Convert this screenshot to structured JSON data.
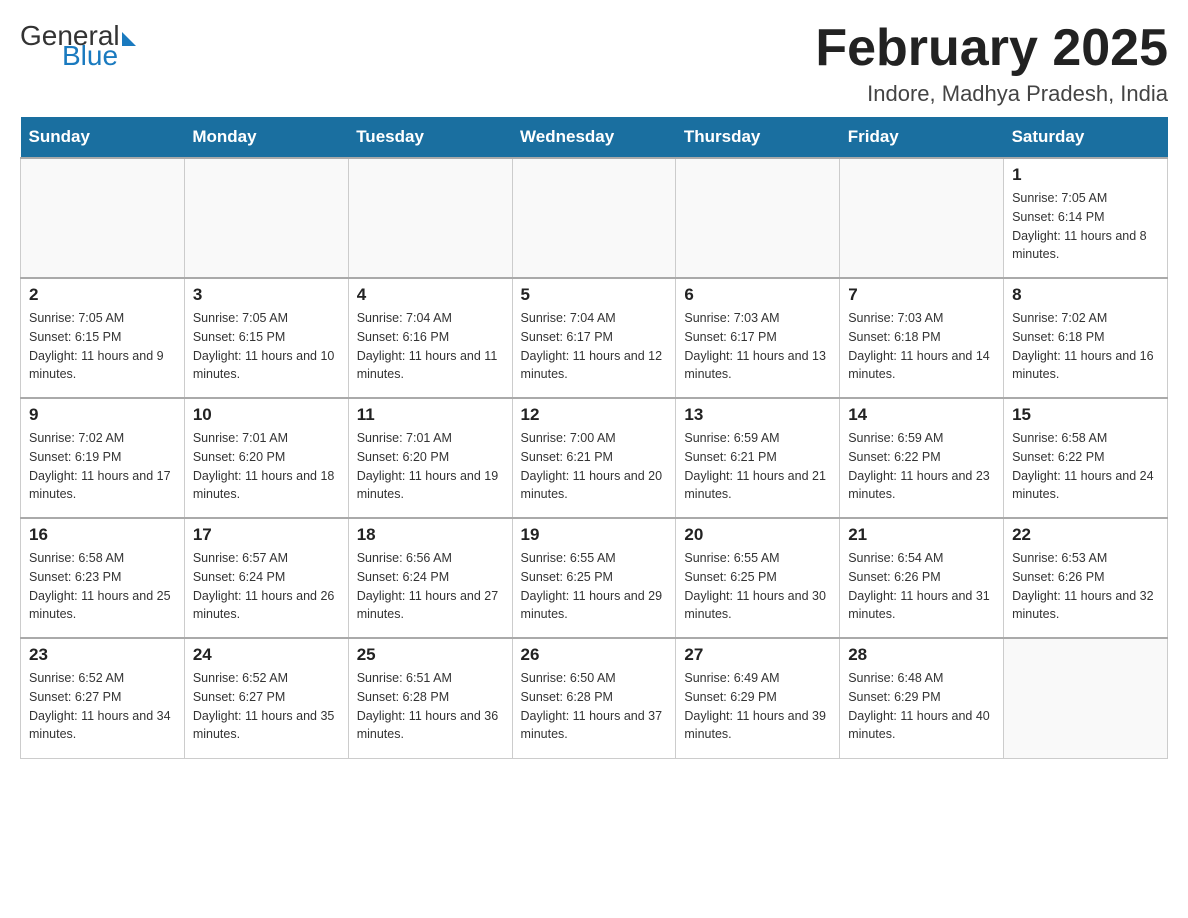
{
  "header": {
    "logo_general": "General",
    "logo_blue": "Blue",
    "month_title": "February 2025",
    "location": "Indore, Madhya Pradesh, India"
  },
  "days_of_week": [
    "Sunday",
    "Monday",
    "Tuesday",
    "Wednesday",
    "Thursday",
    "Friday",
    "Saturday"
  ],
  "weeks": [
    [
      {
        "day": "",
        "info": ""
      },
      {
        "day": "",
        "info": ""
      },
      {
        "day": "",
        "info": ""
      },
      {
        "day": "",
        "info": ""
      },
      {
        "day": "",
        "info": ""
      },
      {
        "day": "",
        "info": ""
      },
      {
        "day": "1",
        "info": "Sunrise: 7:05 AM\nSunset: 6:14 PM\nDaylight: 11 hours and 8 minutes."
      }
    ],
    [
      {
        "day": "2",
        "info": "Sunrise: 7:05 AM\nSunset: 6:15 PM\nDaylight: 11 hours and 9 minutes."
      },
      {
        "day": "3",
        "info": "Sunrise: 7:05 AM\nSunset: 6:15 PM\nDaylight: 11 hours and 10 minutes."
      },
      {
        "day": "4",
        "info": "Sunrise: 7:04 AM\nSunset: 6:16 PM\nDaylight: 11 hours and 11 minutes."
      },
      {
        "day": "5",
        "info": "Sunrise: 7:04 AM\nSunset: 6:17 PM\nDaylight: 11 hours and 12 minutes."
      },
      {
        "day": "6",
        "info": "Sunrise: 7:03 AM\nSunset: 6:17 PM\nDaylight: 11 hours and 13 minutes."
      },
      {
        "day": "7",
        "info": "Sunrise: 7:03 AM\nSunset: 6:18 PM\nDaylight: 11 hours and 14 minutes."
      },
      {
        "day": "8",
        "info": "Sunrise: 7:02 AM\nSunset: 6:18 PM\nDaylight: 11 hours and 16 minutes."
      }
    ],
    [
      {
        "day": "9",
        "info": "Sunrise: 7:02 AM\nSunset: 6:19 PM\nDaylight: 11 hours and 17 minutes."
      },
      {
        "day": "10",
        "info": "Sunrise: 7:01 AM\nSunset: 6:20 PM\nDaylight: 11 hours and 18 minutes."
      },
      {
        "day": "11",
        "info": "Sunrise: 7:01 AM\nSunset: 6:20 PM\nDaylight: 11 hours and 19 minutes."
      },
      {
        "day": "12",
        "info": "Sunrise: 7:00 AM\nSunset: 6:21 PM\nDaylight: 11 hours and 20 minutes."
      },
      {
        "day": "13",
        "info": "Sunrise: 6:59 AM\nSunset: 6:21 PM\nDaylight: 11 hours and 21 minutes."
      },
      {
        "day": "14",
        "info": "Sunrise: 6:59 AM\nSunset: 6:22 PM\nDaylight: 11 hours and 23 minutes."
      },
      {
        "day": "15",
        "info": "Sunrise: 6:58 AM\nSunset: 6:22 PM\nDaylight: 11 hours and 24 minutes."
      }
    ],
    [
      {
        "day": "16",
        "info": "Sunrise: 6:58 AM\nSunset: 6:23 PM\nDaylight: 11 hours and 25 minutes."
      },
      {
        "day": "17",
        "info": "Sunrise: 6:57 AM\nSunset: 6:24 PM\nDaylight: 11 hours and 26 minutes."
      },
      {
        "day": "18",
        "info": "Sunrise: 6:56 AM\nSunset: 6:24 PM\nDaylight: 11 hours and 27 minutes."
      },
      {
        "day": "19",
        "info": "Sunrise: 6:55 AM\nSunset: 6:25 PM\nDaylight: 11 hours and 29 minutes."
      },
      {
        "day": "20",
        "info": "Sunrise: 6:55 AM\nSunset: 6:25 PM\nDaylight: 11 hours and 30 minutes."
      },
      {
        "day": "21",
        "info": "Sunrise: 6:54 AM\nSunset: 6:26 PM\nDaylight: 11 hours and 31 minutes."
      },
      {
        "day": "22",
        "info": "Sunrise: 6:53 AM\nSunset: 6:26 PM\nDaylight: 11 hours and 32 minutes."
      }
    ],
    [
      {
        "day": "23",
        "info": "Sunrise: 6:52 AM\nSunset: 6:27 PM\nDaylight: 11 hours and 34 minutes."
      },
      {
        "day": "24",
        "info": "Sunrise: 6:52 AM\nSunset: 6:27 PM\nDaylight: 11 hours and 35 minutes."
      },
      {
        "day": "25",
        "info": "Sunrise: 6:51 AM\nSunset: 6:28 PM\nDaylight: 11 hours and 36 minutes."
      },
      {
        "day": "26",
        "info": "Sunrise: 6:50 AM\nSunset: 6:28 PM\nDaylight: 11 hours and 37 minutes."
      },
      {
        "day": "27",
        "info": "Sunrise: 6:49 AM\nSunset: 6:29 PM\nDaylight: 11 hours and 39 minutes."
      },
      {
        "day": "28",
        "info": "Sunrise: 6:48 AM\nSunset: 6:29 PM\nDaylight: 11 hours and 40 minutes."
      },
      {
        "day": "",
        "info": ""
      }
    ]
  ]
}
